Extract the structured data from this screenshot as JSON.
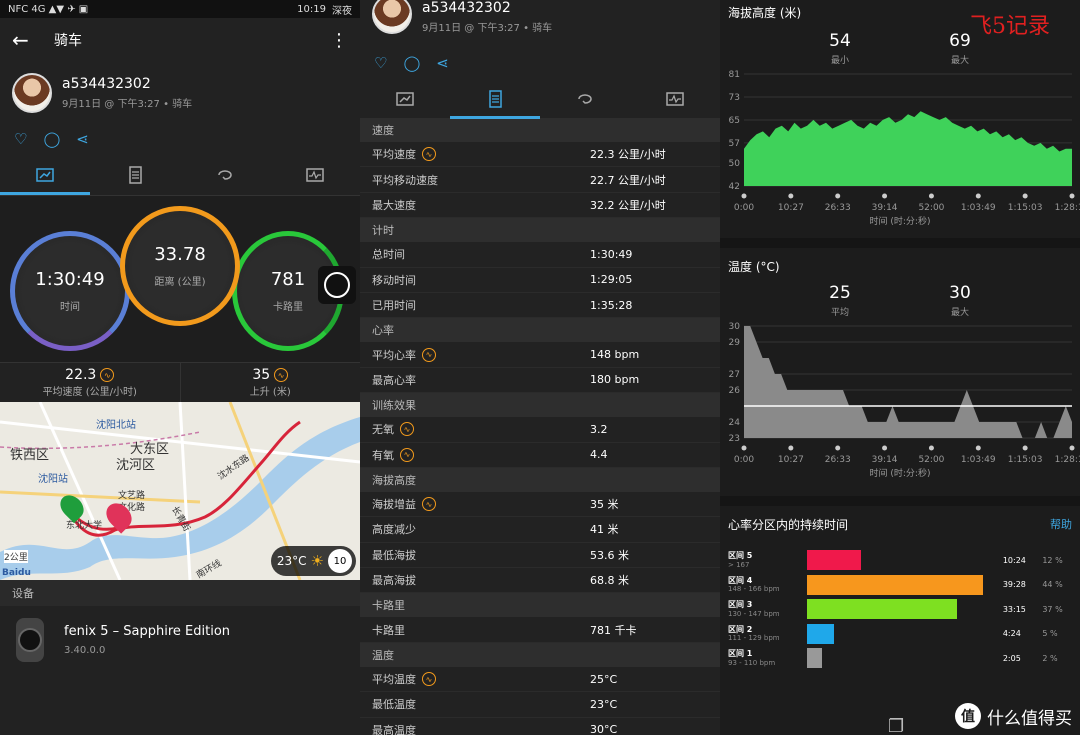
{
  "status": {
    "left": "NFC 4G ▲▼ ✈ ▣",
    "time": "10:19",
    "mode": "深夜"
  },
  "appbar": {
    "title": "骑车"
  },
  "user": {
    "name": "a534432302",
    "meta": "9月11日 @ 下午3:27 • 骑车"
  },
  "rings": {
    "time": {
      "value": "1:30:49",
      "label": "时间"
    },
    "distance": {
      "value": "33.78",
      "label": "距离 (公里)"
    },
    "calories": {
      "value": "781",
      "label": "卡路里"
    }
  },
  "stats2": [
    {
      "value": "22.3",
      "label": "平均速度 (公里/小时)"
    },
    {
      "value": "35",
      "label": "上升 (米)"
    }
  ],
  "map": {
    "labels": [
      "沈阳北站",
      "大东区",
      "沈河区",
      "铁西区",
      "沈阳站",
      "文艺路",
      "文化路",
      "沈水东路",
      "东北大学",
      "长青街",
      "南环线",
      "2公里"
    ],
    "weather": {
      "temp": "23°C",
      "wind": "10"
    }
  },
  "device": {
    "section": "设备",
    "name": "fenix 5 – Sapphire Edition",
    "version": "3.40.0.0"
  },
  "details": [
    {
      "group": "速度",
      "rows": [
        {
          "k": "平均速度",
          "v": "22.3 公里/小时",
          "badge": true
        },
        {
          "k": "平均移动速度",
          "v": "22.7 公里/小时",
          "badge": false
        },
        {
          "k": "最大速度",
          "v": "32.2 公里/小时",
          "badge": false
        }
      ]
    },
    {
      "group": "计时",
      "rows": [
        {
          "k": "总时间",
          "v": "1:30:49",
          "badge": false
        },
        {
          "k": "移动时间",
          "v": "1:29:05",
          "badge": false
        },
        {
          "k": "已用时间",
          "v": "1:35:28",
          "badge": false
        }
      ]
    },
    {
      "group": "心率",
      "rows": [
        {
          "k": "平均心率",
          "v": "148 bpm",
          "badge": true
        },
        {
          "k": "最高心率",
          "v": "180 bpm",
          "badge": false
        }
      ]
    },
    {
      "group": "训练效果",
      "rows": [
        {
          "k": "无氧",
          "v": "3.2",
          "badge": true
        },
        {
          "k": "有氧",
          "v": "4.4",
          "badge": true
        }
      ]
    },
    {
      "group": "海拔高度",
      "rows": [
        {
          "k": "海拔增益",
          "v": "35 米",
          "badge": true
        },
        {
          "k": "高度减少",
          "v": "41 米",
          "badge": false
        },
        {
          "k": "最低海拔",
          "v": "53.6 米",
          "badge": false
        },
        {
          "k": "最高海拔",
          "v": "68.8 米",
          "badge": false
        }
      ]
    },
    {
      "group": "卡路里",
      "rows": [
        {
          "k": "卡路里",
          "v": "781 千卡",
          "badge": false
        }
      ]
    },
    {
      "group": "温度",
      "rows": [
        {
          "k": "平均温度",
          "v": "25°C",
          "badge": true
        },
        {
          "k": "最低温度",
          "v": "23°C",
          "badge": false
        },
        {
          "k": "最高温度",
          "v": "30°C",
          "badge": false
        }
      ]
    }
  ],
  "watermark": "飞5记录",
  "chart_data": [
    {
      "type": "area",
      "title": "海拔高度 (米)",
      "summary": [
        {
          "value": "54",
          "label": "最小"
        },
        {
          "value": "69",
          "label": "最大"
        }
      ],
      "xlabel": "时间 (时:分:秒)",
      "x_ticks": [
        "0:00",
        "10:27",
        "26:33",
        "39:14",
        "52:00",
        "1:03:49",
        "1:15:03",
        "1:28:12"
      ],
      "y_ticks": [
        42,
        50,
        57,
        65,
        73,
        81
      ],
      "ylim": [
        42,
        81
      ],
      "color": "#3fd25a",
      "values": [
        55,
        58,
        60,
        61,
        59,
        62,
        63,
        61,
        64,
        62,
        63,
        65,
        63,
        64,
        62,
        63,
        64,
        65,
        63,
        62,
        64,
        63,
        65,
        66,
        64,
        65,
        67,
        66,
        68,
        67,
        66,
        65,
        66,
        64,
        63,
        62,
        63,
        61,
        62,
        60,
        61,
        59,
        60,
        58,
        59,
        57,
        56,
        57,
        55,
        56,
        54,
        55,
        55
      ]
    },
    {
      "type": "area",
      "title": "温度 (°C)",
      "summary": [
        {
          "value": "25",
          "label": "平均"
        },
        {
          "value": "30",
          "label": "最大"
        }
      ],
      "xlabel": "时间 (时:分:秒)",
      "x_ticks": [
        "0:00",
        "10:27",
        "26:33",
        "39:14",
        "52:00",
        "1:03:49",
        "1:15:03",
        "1:28:12"
      ],
      "y_ticks": [
        23,
        24,
        26,
        27,
        29,
        30
      ],
      "ylim": [
        23,
        30
      ],
      "average": 25,
      "color": "#8a8a8a",
      "values": [
        30,
        30,
        29,
        28,
        28,
        27,
        27,
        26,
        26,
        26,
        26,
        26,
        26,
        26,
        26,
        26,
        26,
        25,
        25,
        25,
        24,
        24,
        24,
        24,
        25,
        24,
        24,
        24,
        24,
        24,
        24,
        24,
        24,
        24,
        24,
        25,
        26,
        25,
        24,
        24,
        24,
        24,
        24,
        24,
        24,
        23,
        23,
        23,
        24,
        23,
        23,
        24,
        25,
        24
      ]
    },
    {
      "type": "bar",
      "title": "心率分区内的持续时间",
      "help": "帮助",
      "categories": [
        "区间 5",
        "区间 4",
        "区间 3",
        "区间 2",
        "区间 1"
      ],
      "ranges": [
        "> 167",
        "148 - 166 bpm",
        "130 - 147 bpm",
        "111 - 129 bpm",
        "93 - 110 bpm"
      ],
      "times": [
        "10:24",
        "39:28",
        "33:15",
        "4:24",
        "2:05"
      ],
      "percent_labels": [
        "12 %",
        "44 %",
        "37 %",
        "5 %",
        "2 %"
      ],
      "values": [
        12,
        44,
        37,
        5,
        2
      ],
      "colors": [
        "#f0194b",
        "#f7971d",
        "#7ee021",
        "#1fa8ea",
        "#999999"
      ]
    }
  ],
  "footer_logo": {
    "glyph": "值",
    "text": "什么值得买"
  }
}
